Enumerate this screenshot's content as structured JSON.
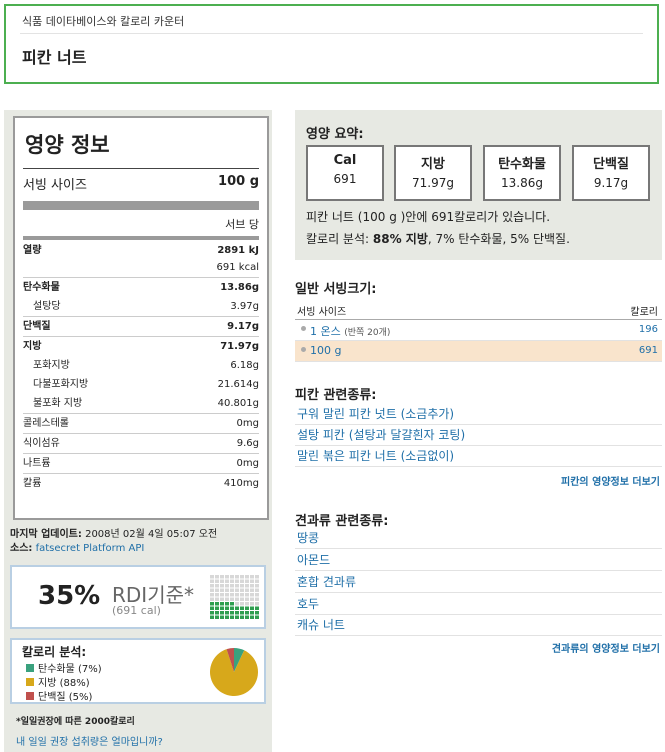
{
  "header": {
    "breadcrumb": "식품 데이타베이스와 칼로리 카운터",
    "title": "피칸 너트"
  },
  "label": {
    "title": "영양 정보",
    "serving_label": "서빙 사이즈",
    "serving_value": "100 g",
    "per_serving": "서브 당",
    "energy": {
      "label": "열량",
      "kj": "2891 kJ",
      "kcal": "691 kcal"
    },
    "rows": [
      {
        "label": "탄수화물",
        "value": "13.86g"
      },
      {
        "label": "설탕당",
        "value": "3.97g"
      },
      {
        "label": "단백질",
        "value": "9.17g"
      },
      {
        "label": "지방",
        "value": "71.97g"
      },
      {
        "label": "포화지방",
        "value": "6.18g"
      },
      {
        "label": "다불포화지방",
        "value": "21.614g"
      },
      {
        "label": "불포화 지방",
        "value": "40.801g"
      },
      {
        "label": "콜레스테롤",
        "value": "0mg"
      },
      {
        "label": "식이섬유",
        "value": "9.6g"
      },
      {
        "label": "나트륨",
        "value": "0mg"
      },
      {
        "label": "칼륨",
        "value": "410mg"
      }
    ]
  },
  "last_updated": {
    "label": "마지막 업데이트:",
    "value": "2008년 02월 4일 05:07 오전"
  },
  "source": {
    "label": "소스:",
    "link": "fatsecret Platform API"
  },
  "rdi": {
    "percent": "35%",
    "text": "RDI기준*",
    "cal": "(691 cal)",
    "fill_fraction": 0.35
  },
  "calorie_breakdown": {
    "title": "칼로리 분석:",
    "items": [
      {
        "label": "탄수화물 (7%)",
        "color": "#3aa17e",
        "pct": 7
      },
      {
        "label": "지방 (88%)",
        "color": "#d7a81b",
        "pct": 88
      },
      {
        "label": "단백질 (5%)",
        "color": "#c0504d",
        "pct": 5
      }
    ]
  },
  "footnote": {
    "line1": "*일일권장에 따른 2000칼로리",
    "line2": "내 일일 권장 섭취량은 얼마입니까?"
  },
  "summary": {
    "title": "영양 요약:",
    "boxes": [
      {
        "label": "Cal",
        "value": "691"
      },
      {
        "label": "지방",
        "value": "71.97g"
      },
      {
        "label": "탄수화물",
        "value": "13.86g"
      },
      {
        "label": "단백질",
        "value": "9.17g"
      }
    ],
    "line1": "피칸 너트 (100 g )안에 691칼로리가 있습니다.",
    "line2_prefix": "칼로리 분석: ",
    "line2_bold": "88% 지방",
    "line2_suffix": ", 7% 탄수화물, 5% 단백질."
  },
  "servings": {
    "title": "일반 서빙크기:",
    "col_size": "서빙 사이즈",
    "col_cal": "칼로리",
    "rows": [
      {
        "size": "1 온스",
        "note": "(반쪽 20개)",
        "cal": "196"
      },
      {
        "size": "100 g",
        "note": "",
        "cal": "691"
      }
    ]
  },
  "related_pecan": {
    "title": "피칸 관련종류:",
    "items": [
      "구워 말린 피칸 넛트 (소금추가)",
      "설탕 피칸 (설탕과 달걀흰자 코팅)",
      "말린 볶은 피칸 너트 (소금없이)"
    ],
    "more": "피칸의 영양정보 더보기"
  },
  "related_nuts": {
    "title": "견과류 관련종류:",
    "items": [
      "땅콩",
      "아몬드",
      "혼합 견과류",
      "호두",
      "캐슈 너트"
    ],
    "more": "견과류의 영양정보 더보기"
  }
}
